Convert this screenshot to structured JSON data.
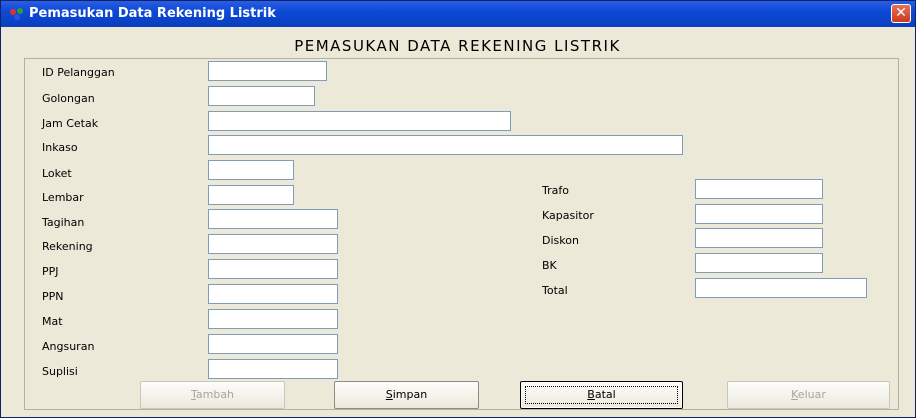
{
  "window": {
    "title": "Pemasukan Data Rekening Listrik",
    "close_glyph": "✕"
  },
  "form": {
    "heading": "PEMASUKAN DATA REKENING LISTRIK",
    "left_fields": [
      {
        "label": "ID Pelanggan",
        "value": ""
      },
      {
        "label": "Golongan",
        "value": ""
      },
      {
        "label": "Jam Cetak",
        "value": ""
      },
      {
        "label": "Inkaso",
        "value": ""
      },
      {
        "label": "Loket",
        "value": ""
      },
      {
        "label": "Lembar",
        "value": ""
      },
      {
        "label": "Tagihan",
        "value": ""
      },
      {
        "label": "Rekening",
        "value": ""
      },
      {
        "label": "PPJ",
        "value": ""
      },
      {
        "label": "PPN",
        "value": ""
      },
      {
        "label": "Mat",
        "value": ""
      },
      {
        "label": "Angsuran",
        "value": ""
      },
      {
        "label": "Suplisi",
        "value": ""
      }
    ],
    "right_fields": [
      {
        "label": "Trafo",
        "value": ""
      },
      {
        "label": "Kapasitor",
        "value": ""
      },
      {
        "label": "Diskon",
        "value": ""
      },
      {
        "label": "BK",
        "value": ""
      },
      {
        "label": "Total",
        "value": ""
      }
    ]
  },
  "buttons": {
    "tambah": {
      "first": "T",
      "rest": "ambah",
      "enabled": false
    },
    "simpan": {
      "first": "S",
      "rest": "impan",
      "enabled": true
    },
    "batal": {
      "first": "B",
      "rest": "atal",
      "enabled": true
    },
    "keluar": {
      "first": "K",
      "rest": "eluar",
      "enabled": false
    }
  },
  "icons": {
    "app": "app-icon",
    "close": "close-icon"
  }
}
